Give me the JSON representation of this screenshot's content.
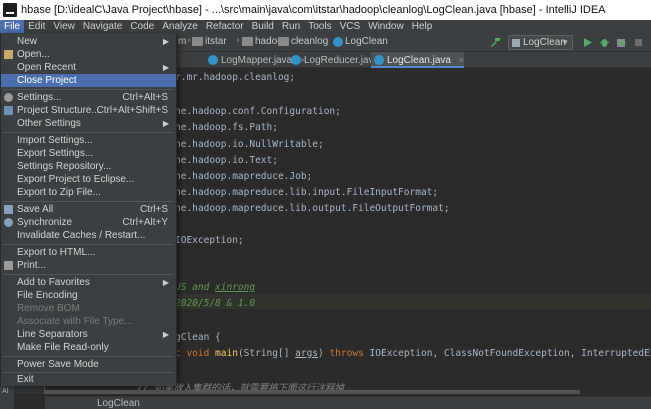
{
  "window": {
    "title": "hbase [D:\\idealC\\Java Project\\hbase] - ...\\src\\main\\java\\com\\itstar\\hadoop\\cleanlog\\LogClean.java [hbase] - IntelliJ IDEA"
  },
  "menubar": {
    "items": [
      "File",
      "Edit",
      "View",
      "Navigate",
      "Code",
      "Analyze",
      "Refactor",
      "Build",
      "Run",
      "Tools",
      "VCS",
      "Window",
      "Help"
    ]
  },
  "navbar": {
    "crumbs": [
      "m",
      "itstar",
      "hadoop",
      "cleanlog",
      "LogClean"
    ],
    "run_config": "LogClean"
  },
  "tabs": [
    {
      "label": "LogMapper.java",
      "close": "×"
    },
    {
      "label": "LogReducer.java",
      "close": "×"
    },
    {
      "label": "LogClean.java",
      "close": "×"
    }
  ],
  "file_menu": {
    "items": [
      {
        "label": "New",
        "arrow": "▶"
      },
      {
        "label": "Open..."
      },
      {
        "label": "Open Recent",
        "arrow": "▶"
      },
      {
        "label": "Close Project"
      },
      {
        "label": "Settings...",
        "shortcut": "Ctrl+Alt+S"
      },
      {
        "label": "Project Structure...",
        "shortcut": "Ctrl+Alt+Shift+S"
      },
      {
        "label": "Other Settings",
        "arrow": "▶"
      },
      {
        "label": "Import Settings..."
      },
      {
        "label": "Export Settings..."
      },
      {
        "label": "Settings Repository..."
      },
      {
        "label": "Export Project to Eclipse..."
      },
      {
        "label": "Export to Zip File..."
      },
      {
        "label": "Save All",
        "shortcut": "Ctrl+S"
      },
      {
        "label": "Synchronize",
        "shortcut": "Ctrl+Alt+Y"
      },
      {
        "label": "Invalidate Caches / Restart..."
      },
      {
        "label": "Export to HTML..."
      },
      {
        "label": "Print..."
      },
      {
        "label": "Add to Favorites",
        "arrow": "▶"
      },
      {
        "label": "File Encoding"
      },
      {
        "label": "Remove BOM"
      },
      {
        "label": "Associate with File Type..."
      },
      {
        "label": "Line Separators",
        "arrow": "▶"
      },
      {
        "label": "Make File Read-only"
      },
      {
        "label": "Power Save Mode"
      },
      {
        "label": "Exit"
      }
    ]
  },
  "code": {
    "lines": [
      "r.mr.hadoop.cleanlog;",
      "he.hadoop.conf.Configuration;",
      "he.hadoop.fs.Path;",
      "he.hadoop.io.NullWritable;",
      "he.hadoop.io.Text;",
      "he.hadoop.mapreduce.Job;",
      "he.hadoop.mapreduce.lib.input.FileInputFormat;",
      "he.hadoop.mapreduce.lib.output.FileOutputFormat;",
      "IOException;",
      "US and ",
      "xinrong",
      "2020/5/8 & 1.0",
      "gClean {",
      "c void ",
      "main",
      "(String[] ",
      "args",
      ") ",
      "throws",
      " IOException, ClassNotFoundException, InterruptedException",
      "// 如果放入集群的话，就需要将下面这行注释掉"
    ]
  },
  "bottom": {
    "breadcrumb": "LogClean",
    "left_strip": "Al"
  },
  "colors": {
    "accent": "#4b6eaf",
    "background": "#2b2b2b",
    "panel": "#3c3f41"
  }
}
